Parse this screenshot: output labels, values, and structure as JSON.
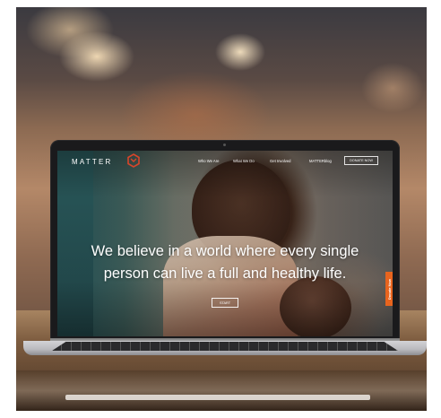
{
  "site": {
    "logo_text": "MATTER",
    "nav": {
      "items": [
        "Who We Are",
        "What We Do",
        "Get Involved",
        "MATTERblog"
      ],
      "donate_label": "DONATE NOW"
    },
    "hero": {
      "headline": "We believe in a world where every single person can live a full and healthy life.",
      "button_label": "START"
    },
    "side_tab_label": "Donate Now"
  },
  "colors": {
    "accent_orange": "#e8641e",
    "logo_red": "#d8452a",
    "text_white": "#ffffff"
  }
}
